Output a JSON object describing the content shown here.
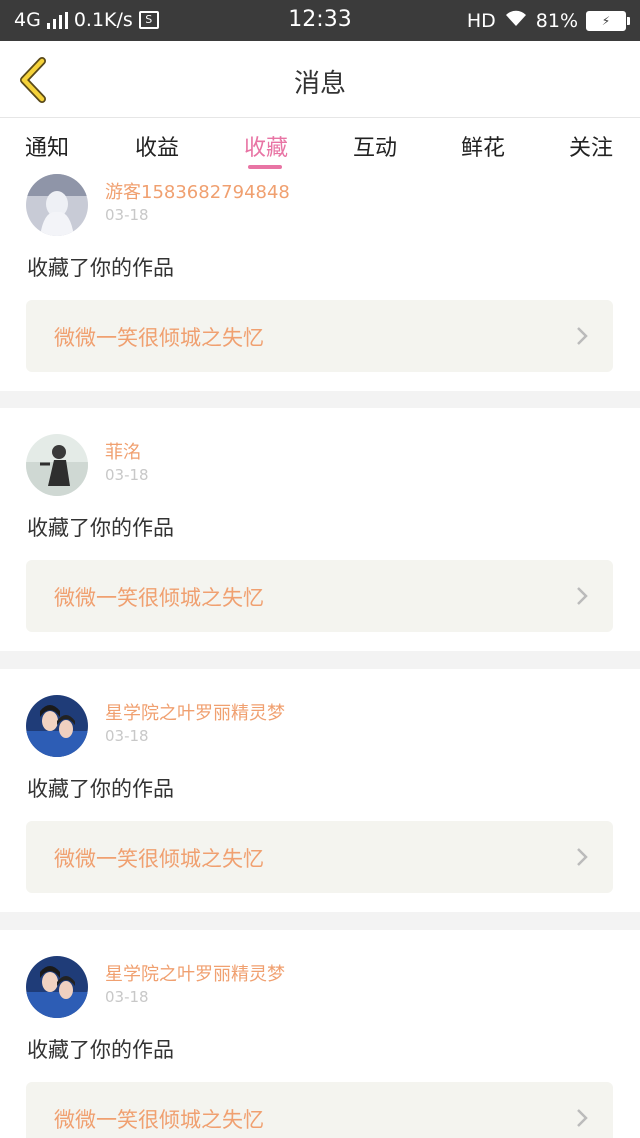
{
  "status_bar": {
    "network": "4G",
    "speed": "0.1K/s",
    "sim_glyph": "S",
    "time": "12:33",
    "hd": "HD",
    "battery": "81%",
    "icons": [
      "signal-icon",
      "sim-icon",
      "wifi-icon",
      "battery-charging-icon"
    ]
  },
  "header": {
    "title": "消息",
    "back_icon": "chevron-left-icon"
  },
  "tabs": [
    {
      "label": "通知",
      "active": false
    },
    {
      "label": "收益",
      "active": false
    },
    {
      "label": "收藏",
      "active": true
    },
    {
      "label": "互动",
      "active": false
    },
    {
      "label": "鲜花",
      "active": false
    },
    {
      "label": "关注",
      "active": false
    }
  ],
  "colors": {
    "accent": "#e874a4",
    "orange": "#f0a070",
    "background": "#f3f3f3",
    "work_bg": "#f4f4ef"
  },
  "messages": [
    {
      "username": "游客1583682794848",
      "date": "03-18",
      "action": "收藏了你的作品",
      "work_title": "微微一笑很倾城之失忆"
    },
    {
      "username": "菲洺",
      "date": "03-18",
      "action": "收藏了你的作品",
      "work_title": "微微一笑很倾城之失忆"
    },
    {
      "username": "星学院之叶罗丽精灵梦",
      "date": "03-18",
      "action": "收藏了你的作品",
      "work_title": "微微一笑很倾城之失忆"
    },
    {
      "username": "星学院之叶罗丽精灵梦",
      "date": "03-18",
      "action": "收藏了你的作品",
      "work_title": "微微一笑很倾城之失忆"
    }
  ]
}
